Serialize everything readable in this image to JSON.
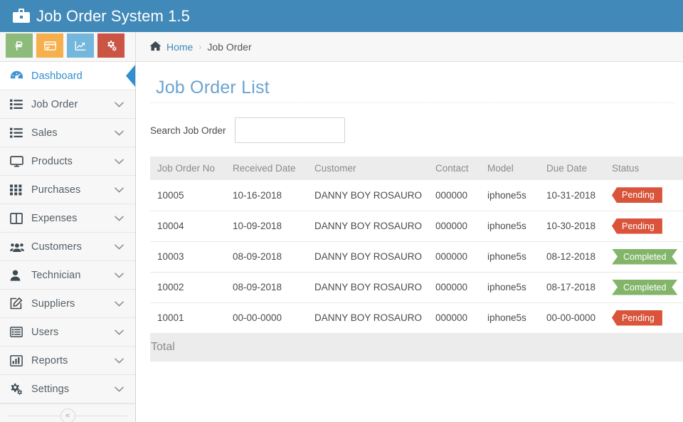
{
  "header": {
    "title": "Job Order System 1.5",
    "brand_icon": "briefcase-icon"
  },
  "quick_tiles": [
    {
      "name": "currency-tile",
      "icon": "peso-sign-icon",
      "color": "#8cbb7c",
      "label": "Currency"
    },
    {
      "name": "payments-tile",
      "icon": "credit-card-icon",
      "color": "#f5b04d",
      "label": "Payments"
    },
    {
      "name": "reports-tile",
      "icon": "line-chart-icon",
      "color": "#74b7dd",
      "label": "Reports"
    },
    {
      "name": "settings-tile",
      "icon": "gears-icon",
      "color": "#cb5544",
      "label": "Settings"
    }
  ],
  "breadcrumb": {
    "home_icon": "home-icon",
    "home": "Home",
    "separator": "›",
    "current": "Job Order"
  },
  "sidebar": {
    "items": [
      {
        "label": "Dashboard",
        "icon": "dashboard-icon",
        "active": true,
        "caret": false
      },
      {
        "label": "Job Order",
        "icon": "list-icon",
        "active": false,
        "caret": true
      },
      {
        "label": "Sales",
        "icon": "list-icon",
        "active": false,
        "caret": true
      },
      {
        "label": "Products",
        "icon": "monitor-icon",
        "active": false,
        "caret": true
      },
      {
        "label": "Purchases",
        "icon": "grid-icon",
        "active": false,
        "caret": true
      },
      {
        "label": "Expenses",
        "icon": "columns-icon",
        "active": false,
        "caret": true
      },
      {
        "label": "Customers",
        "icon": "users-icon",
        "active": false,
        "caret": true
      },
      {
        "label": "Technician",
        "icon": "user-icon",
        "active": false,
        "caret": true
      },
      {
        "label": "Suppliers",
        "icon": "edit-icon",
        "active": false,
        "caret": true
      },
      {
        "label": "Users",
        "icon": "list-alt-icon",
        "active": false,
        "caret": true
      },
      {
        "label": "Reports",
        "icon": "bar-chart-icon",
        "active": false,
        "caret": true
      },
      {
        "label": "Settings",
        "icon": "gears-icon",
        "active": false,
        "caret": true
      }
    ],
    "collapse_glyph": "«",
    "collapse_name": "sidebar-collapse-button"
  },
  "main": {
    "page_title": "Job Order List",
    "search": {
      "label": "Search Job Order",
      "value": "",
      "placeholder": ""
    },
    "table": {
      "columns": [
        "Job Order No",
        "Received Date",
        "Customer",
        "Contact",
        "Model",
        "Due Date",
        "Status"
      ],
      "rows": [
        {
          "job_order_no": "10005",
          "received_date": "10-16-2018",
          "customer": "DANNY BOY ROSAURO",
          "contact": "000000",
          "model": "iphone5s",
          "due_date": "10-31-2018",
          "status": "Pending"
        },
        {
          "job_order_no": "10004",
          "received_date": "10-09-2018",
          "customer": "DANNY BOY ROSAURO",
          "contact": "000000",
          "model": "iphone5s",
          "due_date": "10-30-2018",
          "status": "Pending"
        },
        {
          "job_order_no": "10003",
          "received_date": "08-09-2018",
          "customer": "DANNY BOY ROSAURO",
          "contact": "000000",
          "model": "iphone5s",
          "due_date": "08-12-2018",
          "status": "Completed"
        },
        {
          "job_order_no": "10002",
          "received_date": "08-09-2018",
          "customer": "DANNY BOY ROSAURO",
          "contact": "000000",
          "model": "iphone5s",
          "due_date": "08-17-2018",
          "status": "Completed"
        },
        {
          "job_order_no": "10001",
          "received_date": "00-00-0000",
          "customer": "DANNY BOY ROSAURO",
          "contact": "000000",
          "model": "iphone5s",
          "due_date": "00-00-0000",
          "status": "Pending"
        }
      ],
      "total_label": "Total"
    }
  },
  "colors": {
    "header_blue": "#4189b8",
    "accent_blue": "#2f8fd0",
    "title_blue": "#6ba3cf",
    "status_pending": "#d9543b",
    "status_completed": "#82b56a",
    "sidebar_bg": "#f7f7f7",
    "table_head_bg": "#ececec"
  }
}
